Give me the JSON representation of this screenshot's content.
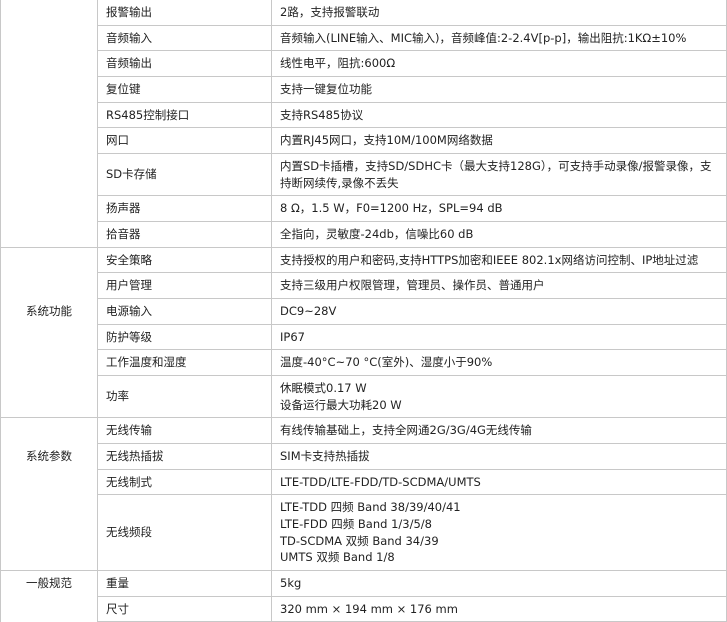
{
  "table": {
    "rows": [
      {
        "category": "",
        "name": "报警输出",
        "values": [
          "2路，支持报警联动"
        ]
      },
      {
        "category": "",
        "name": "音频输入",
        "values": [
          "音频输入(LINE输入、MIC输入)，音频峰值:2-2.4V[p-p]，输出阻抗:1KΩ±10%"
        ]
      },
      {
        "category": "",
        "name": "音频输出",
        "values": [
          "线性电平，阻抗:600Ω"
        ]
      },
      {
        "category": "",
        "name": "复位键",
        "values": [
          "支持一键复位功能"
        ]
      },
      {
        "category": "",
        "name": "RS485控制接口",
        "values": [
          "支持RS485协议"
        ]
      },
      {
        "category": "",
        "name": "网口",
        "values": [
          "内置RJ45网口，支持10M/100M网络数据"
        ]
      },
      {
        "category": "",
        "name": "SD卡存储",
        "values": [
          "内置SD卡插槽，支持SD/SDHC卡（最大支持128G），可支持手动录像/报警录像，支持断网续传,录像不丢失"
        ]
      },
      {
        "category": "",
        "name": "扬声器",
        "values": [
          "8 Ω，1.5 W，F0=1200 Hz，SPL=94 dB"
        ]
      },
      {
        "category": "",
        "name": "拾音器",
        "values": [
          "全指向，灵敏度-24db，信噪比60 dB"
        ]
      },
      {
        "category": "系统功能",
        "name": "安全策略",
        "values": [
          "支持授权的用户和密码,支持HTTPS加密和IEEE 802.1x网络访问控制、IP地址过滤"
        ]
      },
      {
        "category": "",
        "name": "用户管理",
        "values": [
          "支持三级用户权限管理，管理员、操作员、普通用户"
        ]
      },
      {
        "category": "",
        "name": "电源输入",
        "values": [
          "DC9~28V"
        ]
      },
      {
        "category": "",
        "name": "防护等级",
        "values": [
          "IP67"
        ]
      },
      {
        "category": "",
        "name": "工作温度和湿度",
        "values": [
          "温度-40°C~70 °C(室外)、湿度小于90%"
        ]
      },
      {
        "category": "",
        "name": "功率",
        "values": [
          "休眠模式0.17 W",
          "设备运行最大功耗20 W"
        ]
      },
      {
        "category": "系统参数",
        "name": "无线传输",
        "values": [
          "有线传输基础上，支持全网通2G/3G/4G无线传输"
        ]
      },
      {
        "category": "",
        "name": "无线热插拔",
        "values": [
          "SIM卡支持热插拔"
        ]
      },
      {
        "category": "",
        "name": "无线制式",
        "values": [
          "LTE-TDD/LTE-FDD/TD-SCDMA/UMTS"
        ]
      },
      {
        "category": "",
        "name": "无线频段",
        "values": [
          "LTE-TDD 四频 Band 38/39/40/41",
          "LTE-FDD 四频 Band 1/3/5/8",
          "TD-SCDMA 双频 Band 34/39",
          "UMTS 双频 Band 1/8"
        ]
      },
      {
        "category": "一般规范",
        "name": "重量",
        "values": [
          "5kg"
        ]
      },
      {
        "category": "",
        "name": "尺寸",
        "values": [
          "320 mm × 194 mm × 176 mm"
        ]
      }
    ]
  }
}
